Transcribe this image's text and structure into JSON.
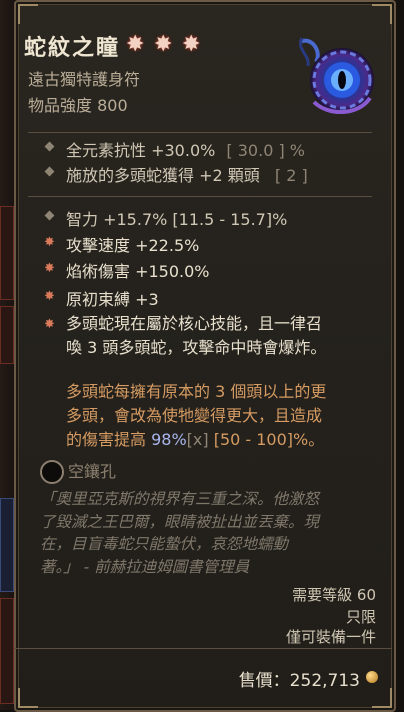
{
  "item": {
    "name": "蛇紋之瞳",
    "type": "遠古獨特護身符",
    "power": "物品強度 800"
  },
  "stats_implicit": [
    {
      "text": "全元素抗性 +30.0%",
      "range": "[ 30.0 ] %"
    },
    {
      "text": "施放的多頭蛇獲得 +2 顆頭",
      "range": "[ 2 ]"
    }
  ],
  "stats": [
    {
      "text": "智力 +15.7% [11.5 - 15.7]%"
    },
    {
      "text": "攻擊速度 +22.5%"
    },
    {
      "text": "焰術傷害 +150.0%"
    },
    {
      "text": "原初束縛 +3"
    }
  ],
  "aspect": {
    "line1": "多頭蛇現在屬於核心技能，且一律召",
    "line2": "喚 3 頭多頭蛇，攻擊命中時會爆炸。",
    "p2_line1": "多頭蛇每擁有原本的 3 個頭以上的更",
    "p2_line2": "多頭，會改為使牠變得更大，且造成",
    "p2_line3_a": "的傷害提高 ",
    "p2_line3_b": "98%",
    "p2_line3_c": "[x]",
    "p2_line3_d": " [50 - 100]%。"
  },
  "socket": {
    "label": "空鑲孔"
  },
  "lore": {
    "l1": "「奧里亞克斯的視界有三重之深。他激怒",
    "l2": "了毀滅之王巴爾，眼睛被扯出並丟棄。現",
    "l3": "在，目盲毒蛇只能蟄伏，哀怨地蠕動",
    "l4": "著。」 - 前赫拉迪姆圖書管理員"
  },
  "requirements": {
    "level": "需要等級 60",
    "bound": "只限",
    "equip": "僅可裝備一件"
  },
  "price": {
    "label": "售價：252,713"
  },
  "colors": {
    "accent_blue": "#a9b6ee",
    "aspect_orange": "#d59b62",
    "title": "#efe6d2"
  },
  "icons": {
    "rarity": "star-icon",
    "amulet": "serpent-eye-amulet-icon",
    "socket": "empty-socket-icon",
    "gold": "gold-coin-icon"
  }
}
